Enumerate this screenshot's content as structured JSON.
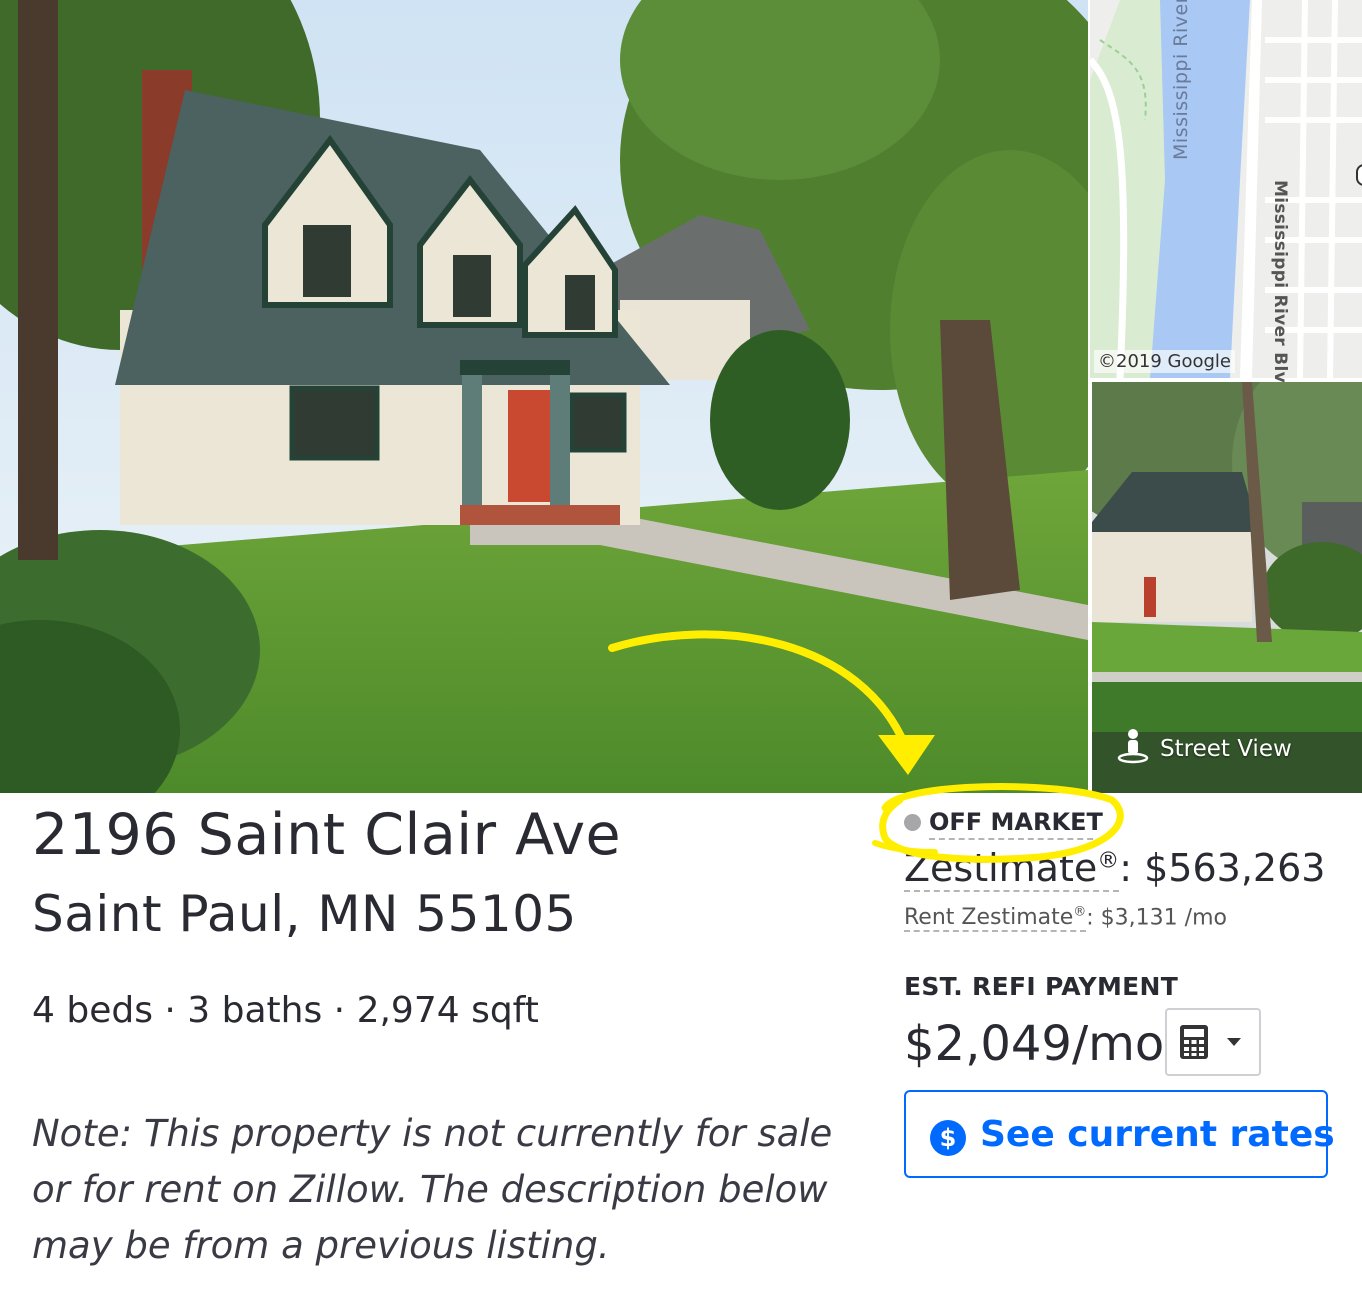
{
  "listing": {
    "street": "2196 Saint Clair Ave",
    "city_line": "Saint Paul, MN 55105",
    "facts": "4 beds · 3 baths · 2,974 sqft",
    "note": "Note: This property is not currently for sale or for rent on Zillow. The description below may be from a previous listing."
  },
  "status": {
    "label": "OFF MARKET",
    "dot_color": "#a7a6ab"
  },
  "zestimate": {
    "label": "Zestimate",
    "reg": "®",
    "value": ": $563,263"
  },
  "rent_zestimate": {
    "label": "Rent Zestimate",
    "reg": "®",
    "value": ": $3,131 /mo"
  },
  "refi": {
    "label": "EST. REFI PAYMENT",
    "amount": "$2,049/mo",
    "calculator_icon": "calculator-icon",
    "dropdown_icon": "caret-down-icon"
  },
  "rates_button": {
    "label": "See current rates",
    "icon": "dollar-circle-icon",
    "icon_glyph": "$",
    "color": "#006aff"
  },
  "map": {
    "river_label": "Mississippi River",
    "road_label": "Mississippi River Blvd",
    "copyright": "©2019 Google"
  },
  "street_view": {
    "label": "Street View",
    "icon": "pegman-icon"
  },
  "annotation": {
    "color": "#ffee00"
  }
}
